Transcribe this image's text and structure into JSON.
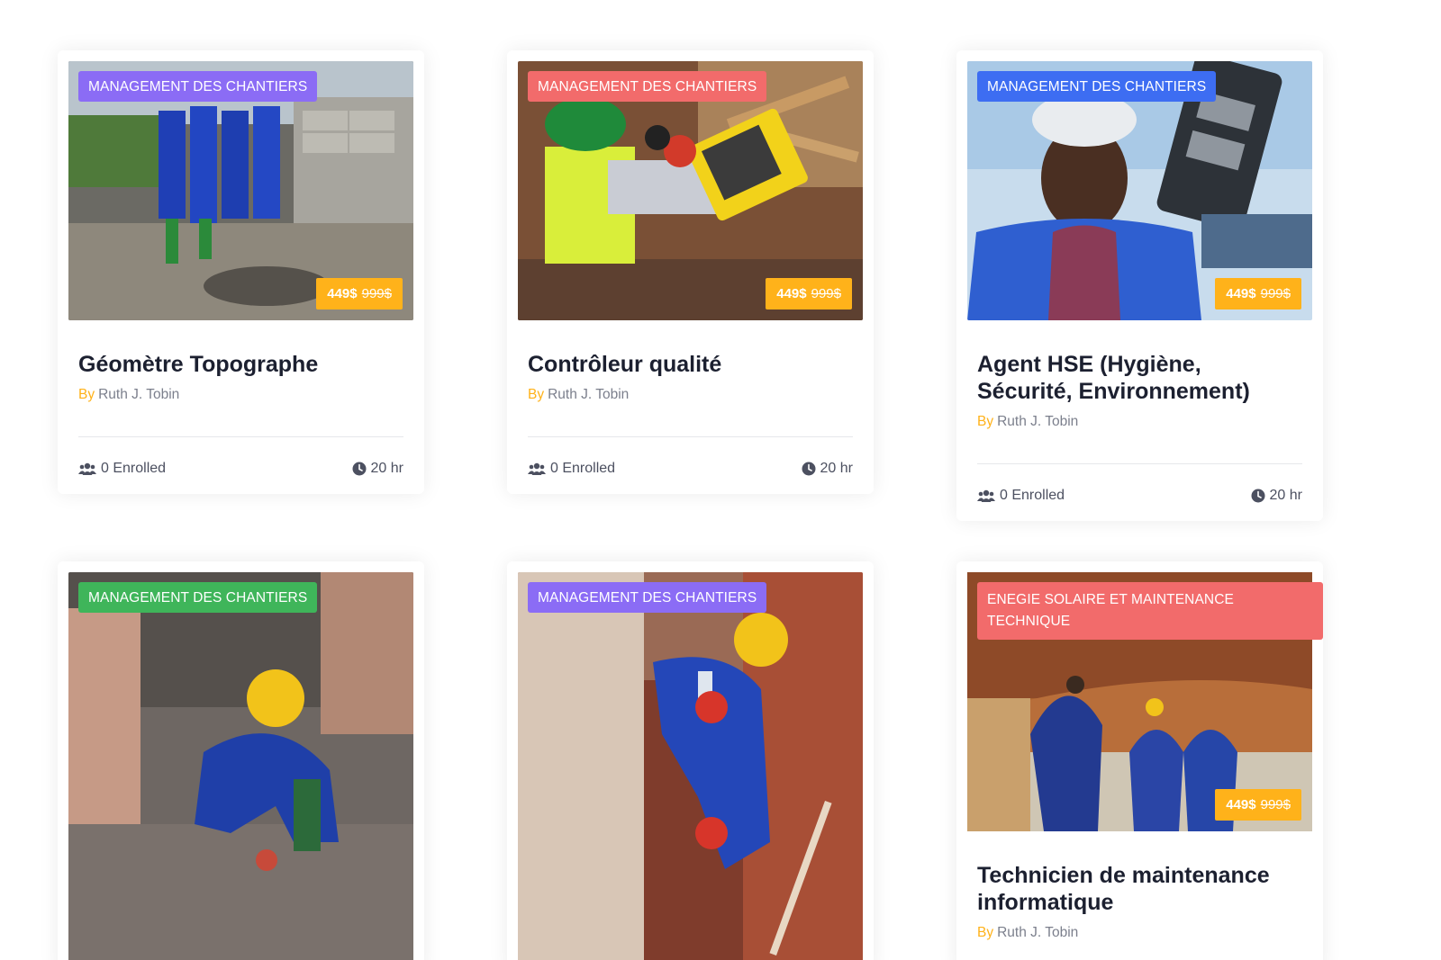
{
  "colors": {
    "badge_purple": "#8b6cf5",
    "badge_red": "#f26b6b",
    "badge_blue": "#3d6df2",
    "badge_green": "#3fb55a",
    "price_bg": "#ffb21a",
    "author_label": "#ffb21a"
  },
  "cards": [
    {
      "category": "MANAGEMENT DES CHANTIERS",
      "price": "449$",
      "old_price": "999$",
      "title": "Géomètre Topographe",
      "by_label": "By",
      "author": "Ruth J. Tobin",
      "enrolled": "0 Enrolled",
      "duration": "20 hr",
      "enrolled_icon": "users-icon",
      "duration_icon": "clock-icon"
    },
    {
      "category": "MANAGEMENT DES CHANTIERS",
      "price": "449$",
      "old_price": "999$",
      "title": "Contrôleur qualité",
      "by_label": "By",
      "author": "Ruth J. Tobin",
      "enrolled": "0 Enrolled",
      "duration": "20 hr"
    },
    {
      "category": "MANAGEMENT DES CHANTIERS",
      "price": "449$",
      "old_price": "999$",
      "title": "Agent HSE (Hygiène, Sécurité, Environnement)",
      "by_label": "By",
      "author": "Ruth J. Tobin",
      "enrolled": "0 Enrolled",
      "duration": "20 hr"
    },
    {
      "category": "MANAGEMENT DES CHANTIERS"
    },
    {
      "category": "MANAGEMENT DES CHANTIERS"
    },
    {
      "category": "ENEGIE SOLAIRE ET MAINTENANCE TECHNIQUE",
      "price": "449$",
      "old_price": "999$",
      "title": "Technicien de maintenance informatique",
      "by_label": "By",
      "author": "Ruth J. Tobin"
    }
  ]
}
